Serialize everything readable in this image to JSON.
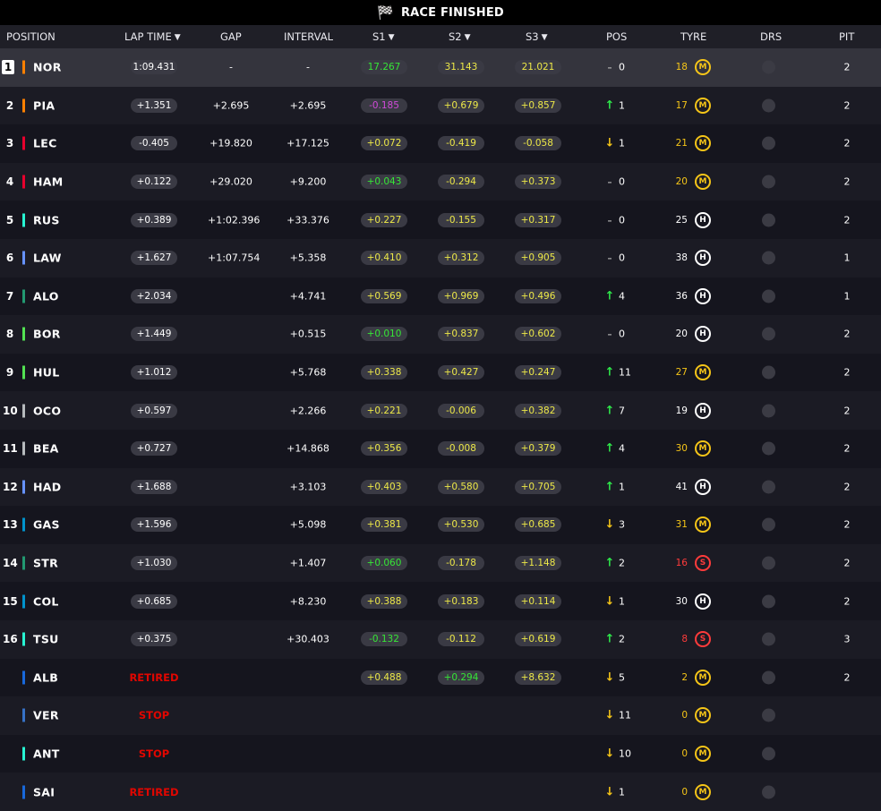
{
  "banner": {
    "title": "RACE FINISHED",
    "icon": "checkered-flag-icon"
  },
  "headers": {
    "position": "POSITION",
    "lap_time": "LAP TIME",
    "gap": "GAP",
    "interval": "INTERVAL",
    "s1": "S1",
    "s2": "S2",
    "s3": "S3",
    "pos": "POS",
    "tyre": "TYRE",
    "drs": "DRS",
    "pit": "PIT"
  },
  "colors": {
    "background": "#15151e",
    "sector_green": "#36e636",
    "sector_purple": "#d14ad9",
    "sector_yellow": "#ede848",
    "retired_red": "#e10600",
    "medium_tyre": "#f5c518",
    "soft_tyre": "#ff3b3b",
    "hard_tyre": "#ffffff"
  },
  "rows": [
    {
      "pos": "1",
      "driver": "NOR",
      "team_color": "#ff8000",
      "lap": "1:09.431",
      "gap": "-",
      "interval": "-",
      "s1": "17.267",
      "s1c": "green",
      "s2": "31.143",
      "s2c": "yellow",
      "s3": "21.021",
      "s3c": "yellow",
      "dir": "same",
      "change": "0",
      "laps": "18",
      "tyre": "M",
      "pit": "2"
    },
    {
      "pos": "2",
      "driver": "PIA",
      "team_color": "#ff8000",
      "lap": "+1.351",
      "gap": "+2.695",
      "interval": "+2.695",
      "s1": "-0.185",
      "s1c": "purple",
      "s2": "+0.679",
      "s2c": "yellow",
      "s3": "+0.857",
      "s3c": "yellow",
      "dir": "up",
      "change": "1",
      "laps": "17",
      "tyre": "M",
      "pit": "2"
    },
    {
      "pos": "3",
      "driver": "LEC",
      "team_color": "#e8002d",
      "lap": "-0.405",
      "gap": "+19.820",
      "interval": "+17.125",
      "s1": "+0.072",
      "s1c": "yellow",
      "s2": "-0.419",
      "s2c": "yellow",
      "s3": "-0.058",
      "s3c": "yellow",
      "dir": "down",
      "change": "1",
      "laps": "21",
      "tyre": "M",
      "pit": "2"
    },
    {
      "pos": "4",
      "driver": "HAM",
      "team_color": "#e8002d",
      "lap": "+0.122",
      "gap": "+29.020",
      "interval": "+9.200",
      "s1": "+0.043",
      "s1c": "green",
      "s2": "-0.294",
      "s2c": "yellow",
      "s3": "+0.373",
      "s3c": "yellow",
      "dir": "same",
      "change": "0",
      "laps": "20",
      "tyre": "M",
      "pit": "2"
    },
    {
      "pos": "5",
      "driver": "RUS",
      "team_color": "#27f4d2",
      "lap": "+0.389",
      "gap": "+1:02.396",
      "interval": "+33.376",
      "s1": "+0.227",
      "s1c": "yellow",
      "s2": "-0.155",
      "s2c": "yellow",
      "s3": "+0.317",
      "s3c": "yellow",
      "dir": "same",
      "change": "0",
      "laps": "25",
      "tyre": "H",
      "pit": "2"
    },
    {
      "pos": "6",
      "driver": "LAW",
      "team_color": "#6692ff",
      "lap": "+1.627",
      "gap": "+1:07.754",
      "interval": "+5.358",
      "s1": "+0.410",
      "s1c": "yellow",
      "s2": "+0.312",
      "s2c": "yellow",
      "s3": "+0.905",
      "s3c": "yellow",
      "dir": "same",
      "change": "0",
      "laps": "38",
      "tyre": "H",
      "pit": "1"
    },
    {
      "pos": "7",
      "driver": "ALO",
      "team_color": "#229971",
      "lap": "+2.034",
      "gap": "",
      "interval": "+4.741",
      "s1": "+0.569",
      "s1c": "yellow",
      "s2": "+0.969",
      "s2c": "yellow",
      "s3": "+0.496",
      "s3c": "yellow",
      "dir": "up",
      "change": "4",
      "laps": "36",
      "tyre": "H",
      "pit": "1"
    },
    {
      "pos": "8",
      "driver": "BOR",
      "team_color": "#52e252",
      "lap": "+1.449",
      "gap": "",
      "interval": "+0.515",
      "s1": "+0.010",
      "s1c": "green",
      "s2": "+0.837",
      "s2c": "yellow",
      "s3": "+0.602",
      "s3c": "yellow",
      "dir": "same",
      "change": "0",
      "laps": "20",
      "tyre": "H",
      "pit": "2"
    },
    {
      "pos": "9",
      "driver": "HUL",
      "team_color": "#52e252",
      "lap": "+1.012",
      "gap": "",
      "interval": "+5.768",
      "s1": "+0.338",
      "s1c": "yellow",
      "s2": "+0.427",
      "s2c": "yellow",
      "s3": "+0.247",
      "s3c": "yellow",
      "dir": "up",
      "change": "11",
      "laps": "27",
      "tyre": "M",
      "pit": "2"
    },
    {
      "pos": "10",
      "driver": "OCO",
      "team_color": "#b6babd",
      "lap": "+0.597",
      "gap": "",
      "interval": "+2.266",
      "s1": "+0.221",
      "s1c": "yellow",
      "s2": "-0.006",
      "s2c": "yellow",
      "s3": "+0.382",
      "s3c": "yellow",
      "dir": "up",
      "change": "7",
      "laps": "19",
      "tyre": "H",
      "pit": "2"
    },
    {
      "pos": "11",
      "driver": "BEA",
      "team_color": "#b6babd",
      "lap": "+0.727",
      "gap": "",
      "interval": "+14.868",
      "s1": "+0.356",
      "s1c": "yellow",
      "s2": "-0.008",
      "s2c": "yellow",
      "s3": "+0.379",
      "s3c": "yellow",
      "dir": "up",
      "change": "4",
      "laps": "30",
      "tyre": "M",
      "pit": "2"
    },
    {
      "pos": "12",
      "driver": "HAD",
      "team_color": "#6692ff",
      "lap": "+1.688",
      "gap": "",
      "interval": "+3.103",
      "s1": "+0.403",
      "s1c": "yellow",
      "s2": "+0.580",
      "s2c": "yellow",
      "s3": "+0.705",
      "s3c": "yellow",
      "dir": "up",
      "change": "1",
      "laps": "41",
      "tyre": "H",
      "pit": "2"
    },
    {
      "pos": "13",
      "driver": "GAS",
      "team_color": "#0093cc",
      "lap": "+1.596",
      "gap": "",
      "interval": "+5.098",
      "s1": "+0.381",
      "s1c": "yellow",
      "s2": "+0.530",
      "s2c": "yellow",
      "s3": "+0.685",
      "s3c": "yellow",
      "dir": "down",
      "change": "3",
      "laps": "31",
      "tyre": "M",
      "pit": "2"
    },
    {
      "pos": "14",
      "driver": "STR",
      "team_color": "#229971",
      "lap": "+1.030",
      "gap": "",
      "interval": "+1.407",
      "s1": "+0.060",
      "s1c": "green",
      "s2": "-0.178",
      "s2c": "yellow",
      "s3": "+1.148",
      "s3c": "yellow",
      "dir": "up",
      "change": "2",
      "laps": "16",
      "tyre": "S",
      "pit": "2"
    },
    {
      "pos": "15",
      "driver": "COL",
      "team_color": "#0093cc",
      "lap": "+0.685",
      "gap": "",
      "interval": "+8.230",
      "s1": "+0.388",
      "s1c": "yellow",
      "s2": "+0.183",
      "s2c": "yellow",
      "s3": "+0.114",
      "s3c": "yellow",
      "dir": "down",
      "change": "1",
      "laps": "30",
      "tyre": "H",
      "pit": "2"
    },
    {
      "pos": "16",
      "driver": "TSU",
      "team_color": "#27f4d2",
      "lap": "+0.375",
      "gap": "",
      "interval": "+30.403",
      "s1": "-0.132",
      "s1c": "green",
      "s2": "-0.112",
      "s2c": "yellow",
      "s3": "+0.619",
      "s3c": "yellow",
      "dir": "up",
      "change": "2",
      "laps": "8",
      "tyre": "S",
      "pit": "3"
    },
    {
      "pos": "",
      "driver": "ALB",
      "team_color": "#1868db",
      "status": "RETIRED",
      "gap": "",
      "interval": "",
      "s1": "+0.488",
      "s1c": "yellow",
      "s2": "+0.294",
      "s2c": "green",
      "s3": "+8.632",
      "s3c": "yellow",
      "dir": "down",
      "change": "5",
      "laps": "2",
      "tyre": "M",
      "pit": "2"
    },
    {
      "pos": "",
      "driver": "VER",
      "team_color": "#3671c6",
      "status": "STOP",
      "gap": "",
      "interval": "",
      "s1": "",
      "s2": "",
      "s3": "",
      "dir": "down",
      "change": "11",
      "laps": "0",
      "tyre": "M",
      "pit": ""
    },
    {
      "pos": "",
      "driver": "ANT",
      "team_color": "#27f4d2",
      "status": "STOP",
      "gap": "",
      "interval": "",
      "s1": "",
      "s2": "",
      "s3": "",
      "dir": "down",
      "change": "10",
      "laps": "0",
      "tyre": "M",
      "pit": ""
    },
    {
      "pos": "",
      "driver": "SAI",
      "team_color": "#1868db",
      "status": "RETIRED",
      "gap": "",
      "interval": "",
      "s1": "",
      "s2": "",
      "s3": "",
      "dir": "down",
      "change": "1",
      "laps": "0",
      "tyre": "M",
      "pit": ""
    }
  ]
}
